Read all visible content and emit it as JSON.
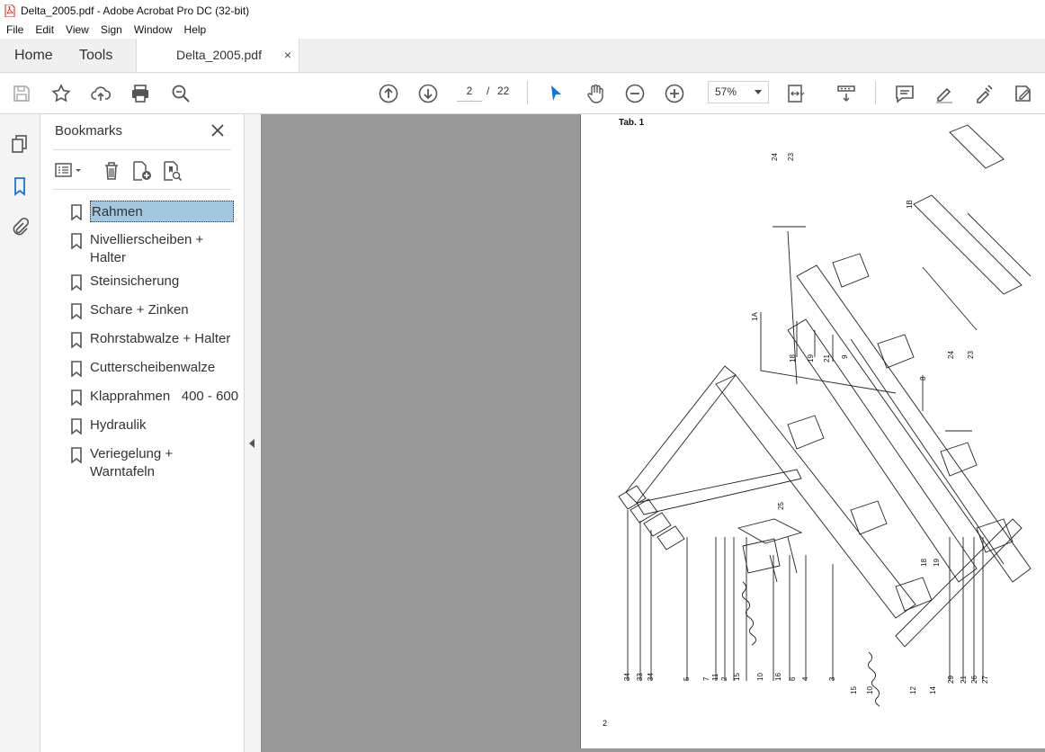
{
  "window": {
    "title": "Delta_2005.pdf - Adobe Acrobat Pro DC (32-bit)"
  },
  "menu": [
    "File",
    "Edit",
    "View",
    "Sign",
    "Window",
    "Help"
  ],
  "tabs": {
    "home": "Home",
    "tools": "Tools",
    "document": "Delta_2005.pdf",
    "close_glyph": "×"
  },
  "toolbar": {
    "page_current": "2",
    "page_separator": "/",
    "page_total": "22",
    "zoom": "57%"
  },
  "bookmarks": {
    "title": "Bookmarks",
    "items": [
      {
        "label": "Rahmen",
        "selected": true
      },
      {
        "label": "Nivellierscheiben +\nHalter"
      },
      {
        "label": "Steinsicherung"
      },
      {
        "label": "Schare + Zinken"
      },
      {
        "label": "Rohrstabwalze + Halter"
      },
      {
        "label": "Cutterscheibenwalze"
      },
      {
        "label": "Klapprahmen   400 - 600"
      },
      {
        "label": "Hydraulik"
      },
      {
        "label": "Veriegelung +\nWarntafeln"
      }
    ]
  },
  "document": {
    "table_label": "Tab. 1",
    "page_number": "2",
    "callouts_top": [
      "24",
      "23",
      "1B",
      "1A",
      "18",
      "19",
      "21",
      "9",
      "8",
      "24",
      "23"
    ],
    "callouts_right": [
      "25",
      "18",
      "19"
    ],
    "callouts_bottom": [
      "34",
      "33",
      "34",
      "5",
      "7",
      "11",
      "2",
      "15",
      "10",
      "16",
      "6",
      "4",
      "3",
      "15",
      "10",
      "12",
      "14",
      "29",
      "21",
      "26",
      "27"
    ]
  },
  "colors": {
    "accent_blue": "#1473e6",
    "selection": "#a4c7e1",
    "doc_background": "#999999"
  }
}
